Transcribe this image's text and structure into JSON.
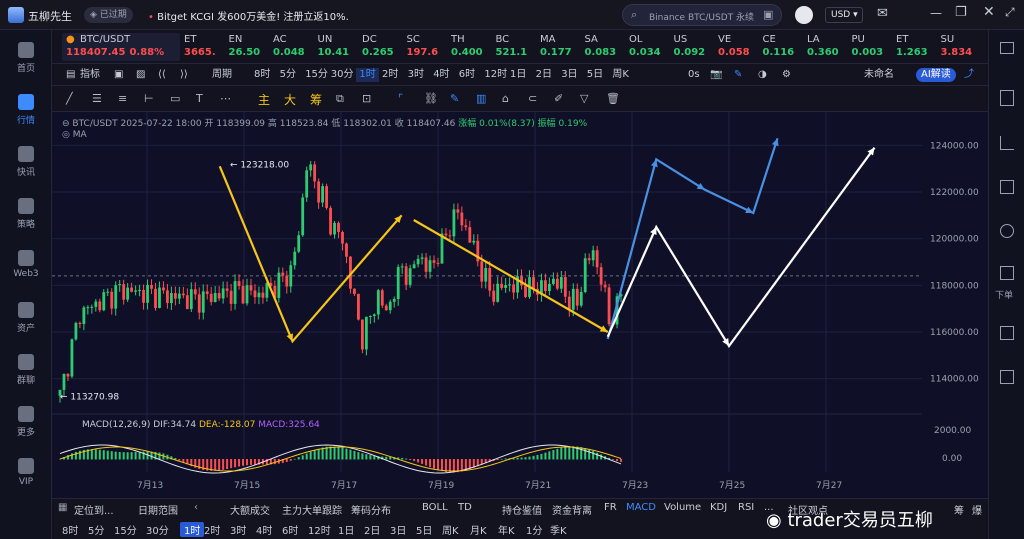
{
  "app": {
    "name": "五柳先生",
    "status": "已过期",
    "news": "Bitget KCGI 发600万美金! 注册立返10%...",
    "search_placeholder": "Binance BTC/USDT 永续",
    "currency": "USD"
  },
  "nav_left": [
    {
      "label": "首页",
      "icon": "home-icon"
    },
    {
      "label": "行情",
      "icon": "chart-bars-icon",
      "active": true
    },
    {
      "label": "快讯",
      "icon": "news-icon"
    },
    {
      "label": "策略",
      "icon": "robot-icon"
    },
    {
      "label": "Web3",
      "icon": "web3-icon"
    },
    {
      "label": "资产",
      "icon": "wallet-icon"
    },
    {
      "label": "群聊",
      "icon": "chat-icon"
    },
    {
      "label": "更多",
      "icon": "grid-icon"
    },
    {
      "label": "VIP",
      "icon": "diamond-icon"
    }
  ],
  "nav_right": {
    "next": "下单"
  },
  "tickers": [
    {
      "symbol": "BTC/USDT",
      "price": "118407.45",
      "change": "0.88%",
      "color": "#ff4d4f",
      "main": true
    },
    {
      "symbol": "ET",
      "price": "3665.",
      "color": "#ff4d4f"
    },
    {
      "symbol": "EN",
      "price": "26.50",
      "color": "#2ecc71"
    },
    {
      "symbol": "AC",
      "price": "0.048",
      "color": "#2ecc71"
    },
    {
      "symbol": "UN",
      "price": "10.41",
      "color": "#2ecc71"
    },
    {
      "symbol": "DC",
      "price": "0.265",
      "color": "#2ecc71"
    },
    {
      "symbol": "SC",
      "price": "197.6",
      "color": "#ff4d4f"
    },
    {
      "symbol": "TH",
      "price": "0.400",
      "color": "#2ecc71"
    },
    {
      "symbol": "BC",
      "price": "521.1",
      "color": "#2ecc71"
    },
    {
      "symbol": "MA",
      "price": "0.177",
      "color": "#2ecc71"
    },
    {
      "symbol": "SA",
      "price": "0.083",
      "color": "#2ecc71"
    },
    {
      "symbol": "OL",
      "price": "0.034",
      "color": "#2ecc71"
    },
    {
      "symbol": "US",
      "price": "0.092",
      "color": "#2ecc71"
    },
    {
      "symbol": "VE",
      "price": "0.058",
      "color": "#ff4d4f"
    },
    {
      "symbol": "CE",
      "price": "0.116",
      "color": "#2ecc71"
    },
    {
      "symbol": "LA",
      "price": "0.360",
      "color": "#2ecc71"
    },
    {
      "symbol": "PU",
      "price": "0.003",
      "color": "#2ecc71"
    },
    {
      "symbol": "ET",
      "price": "1.263",
      "color": "#2ecc71"
    },
    {
      "symbol": "SU",
      "price": "3.834",
      "color": "#ff4d4f"
    }
  ],
  "toolbar1": {
    "indicator": "指标",
    "period": "周期",
    "intervals": [
      "8时",
      "5分",
      "15分",
      "30分",
      "1时",
      "2时",
      "3时",
      "4时",
      "6时",
      "12时",
      "1日",
      "2日",
      "3日",
      "5日",
      "周K"
    ],
    "active_interval": "1时",
    "countdown": "0s",
    "layout_name": "未命名",
    "ai": "AI解读"
  },
  "toolbar2": {
    "main": "主",
    "big": "大",
    "chip": "筹"
  },
  "chart_header": {
    "symbol": "BTC/USDT",
    "time": "2025-07-22 18:00",
    "open_label": "开",
    "open": "118399.09",
    "high_label": "高",
    "high": "118523.84",
    "low_label": "低",
    "low": "118302.01",
    "close_label": "收",
    "close": "118407.46",
    "change_label": "涨幅",
    "change": "0.01%(8.37)",
    "amp_label": "振幅",
    "amp": "0.19%",
    "ma": "MA"
  },
  "chart_data": {
    "type": "line",
    "title": "",
    "x": [
      "7月13",
      "7月15",
      "7月17",
      "7月19",
      "7月21",
      "7月23",
      "7月25",
      "7月27"
    ],
    "ylim": [
      113000,
      125000
    ],
    "yticks": [
      114000,
      116000,
      118000,
      120000,
      122000,
      124000
    ],
    "ytick_labels": [
      "114000.00",
      "116000.00",
      "118000.00",
      "120000.00",
      "122000.00",
      "124000.00"
    ],
    "annotations": {
      "high": "123218.00",
      "low": "113270.98"
    },
    "price_path": [
      [
        0,
        113270.98
      ],
      [
        5,
        116800
      ],
      [
        10,
        117300
      ],
      [
        15,
        117800
      ],
      [
        20,
        117700
      ],
      [
        25,
        117600
      ],
      [
        30,
        117500
      ],
      [
        35,
        117400
      ],
      [
        40,
        117600
      ],
      [
        45,
        117800
      ],
      [
        50,
        117600
      ],
      [
        55,
        118100
      ],
      [
        58,
        118600
      ],
      [
        60,
        120200
      ],
      [
        62,
        123218
      ],
      [
        64,
        122400
      ],
      [
        66,
        121800
      ],
      [
        68,
        120600
      ],
      [
        70,
        120300
      ],
      [
        72,
        119200
      ],
      [
        74,
        117200
      ],
      [
        76,
        115800
      ],
      [
        78,
        116600
      ],
      [
        80,
        117600
      ],
      [
        82,
        116800
      ],
      [
        84,
        117800
      ],
      [
        86,
        118800
      ],
      [
        88,
        118300
      ],
      [
        90,
        119400
      ],
      [
        92,
        118700
      ],
      [
        94,
        119000
      ],
      [
        96,
        119700
      ],
      [
        98,
        120600
      ],
      [
        100,
        121100
      ],
      [
        102,
        120400
      ],
      [
        104,
        119600
      ],
      [
        106,
        118600
      ],
      [
        108,
        117800
      ],
      [
        110,
        117700
      ],
      [
        112,
        118100
      ],
      [
        114,
        117900
      ],
      [
        116,
        118100
      ],
      [
        118,
        117800
      ],
      [
        120,
        118000
      ],
      [
        122,
        117800
      ],
      [
        124,
        118300
      ],
      [
        126,
        117900
      ],
      [
        128,
        117400
      ],
      [
        130,
        117200
      ],
      [
        132,
        118900
      ],
      [
        134,
        119400
      ],
      [
        136,
        118300
      ],
      [
        138,
        116500
      ],
      [
        140,
        117000
      ],
      [
        142,
        118400
      ]
    ],
    "projection_lines": [
      {
        "color": "#f5c518",
        "points": [
          [
            "7月14 12时",
            123100
          ],
          [
            "7月16 00时",
            115600
          ],
          [
            "7月18 06时",
            121000
          ]
        ]
      },
      {
        "color": "#f5c518",
        "points": [
          [
            "7月18 12时",
            120800
          ],
          [
            "7月22 12时",
            116000
          ]
        ]
      },
      {
        "color": "#4a90e2",
        "points": [
          [
            "7月22 12时",
            115700
          ],
          [
            "7月23 12时",
            123400
          ],
          [
            "7月24 12时",
            122100
          ],
          [
            "7月25 12时",
            121100
          ],
          [
            "7月26 00时",
            124300
          ]
        ]
      },
      {
        "color": "#ffffff",
        "points": [
          [
            "7月22 12时",
            115800
          ],
          [
            "7月23 12时",
            120500
          ],
          [
            "7月25 00時",
            115400
          ],
          [
            "7月28 00时",
            123900
          ]
        ]
      }
    ]
  },
  "macd": {
    "label": "MACD(12,26,9)",
    "dif_label": "DIF:",
    "dif": "34.74",
    "dea_label": "DEA:",
    "dea": "-128.07",
    "macd_label": "MACD:",
    "macd": "325.64",
    "ytick_labels": [
      "2000.00",
      "0.00"
    ]
  },
  "bottom": {
    "locate": "定位到...",
    "range": "日期范围",
    "items": [
      "大额成交",
      "主力大单跟踪",
      "筹码分布",
      "BOLL",
      "TD"
    ],
    "items2": [
      "持仓鉴值",
      "资金背离",
      "FR",
      "MACD",
      "Volume",
      "KDJ",
      "RSI",
      "...",
      "社区观点"
    ],
    "extra": [
      "筹",
      "爆"
    ]
  },
  "intervals_bottom": [
    "8时",
    "5分",
    "15分",
    "30分",
    "1时",
    "2时",
    "3时",
    "4时",
    "6时",
    "12时",
    "1日",
    "2日",
    "3日",
    "5日",
    "周K",
    "月K",
    "年K",
    "1分",
    "季K"
  ],
  "watermark": "trader交易员五柳"
}
